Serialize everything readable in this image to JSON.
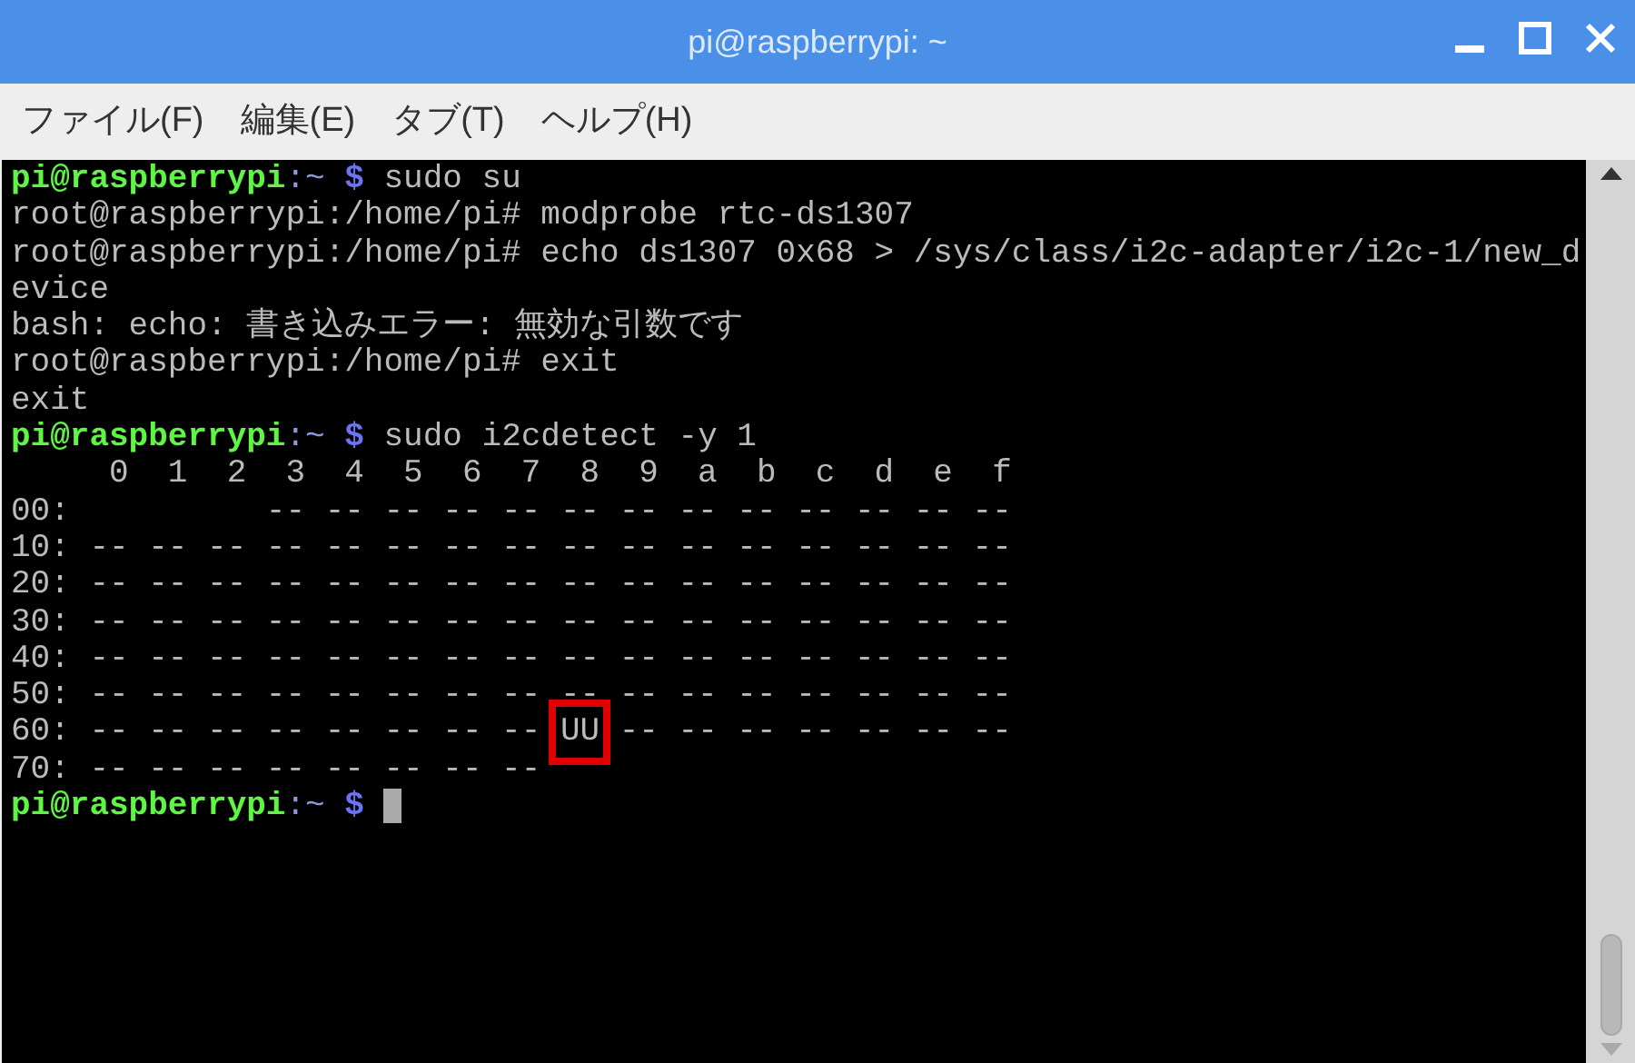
{
  "window": {
    "title": "pi@raspberrypi: ~"
  },
  "menu": [
    "ファイル(F)",
    "編集(E)",
    "タブ(T)",
    "ヘルプ(H)"
  ],
  "terminal": {
    "lines": [
      [
        {
          "kind": "user",
          "text": "pi@raspberrypi"
        },
        {
          "kind": "path",
          "text": ":~"
        },
        {
          "kind": "dollar",
          "text": " $"
        },
        {
          "kind": "text",
          "text": " sudo su"
        }
      ],
      [
        {
          "kind": "text",
          "text": "root@raspberrypi:/home/pi# modprobe rtc-ds1307"
        }
      ],
      [
        {
          "kind": "text",
          "text": "root@raspberrypi:/home/pi# echo ds1307 0x68 > /sys/class/i2c-adapter/i2c-1/new_d"
        }
      ],
      [
        {
          "kind": "text",
          "text": "evice"
        }
      ],
      [
        {
          "kind": "text",
          "text": "bash: echo: 書き込みエラー: 無効な引数です"
        }
      ],
      [
        {
          "kind": "text",
          "text": "root@raspberrypi:/home/pi# exit"
        }
      ],
      [
        {
          "kind": "text",
          "text": "exit"
        }
      ],
      [
        {
          "kind": "user",
          "text": "pi@raspberrypi"
        },
        {
          "kind": "path",
          "text": ":~"
        },
        {
          "kind": "dollar",
          "text": " $"
        },
        {
          "kind": "text",
          "text": " sudo i2cdetect -y 1"
        }
      ],
      [
        {
          "kind": "text",
          "text": "     0  1  2  3  4  5  6  7  8  9  a  b  c  d  e  f"
        }
      ],
      [
        {
          "kind": "text",
          "text": "00:          -- -- -- -- -- -- -- -- -- -- -- -- --"
        }
      ],
      [
        {
          "kind": "text",
          "text": "10: -- -- -- -- -- -- -- -- -- -- -- -- -- -- -- --"
        }
      ],
      [
        {
          "kind": "text",
          "text": "20: -- -- -- -- -- -- -- -- -- -- -- -- -- -- -- --"
        }
      ],
      [
        {
          "kind": "text",
          "text": "30: -- -- -- -- -- -- -- -- -- -- -- -- -- -- -- --"
        }
      ],
      [
        {
          "kind": "text",
          "text": "40: -- -- -- -- -- -- -- -- -- -- -- -- -- -- -- --"
        }
      ],
      [
        {
          "kind": "text",
          "text": "50: -- -- -- -- -- -- -- -- -- -- -- -- -- -- -- --"
        }
      ],
      [
        {
          "kind": "text",
          "text": "60: -- -- -- -- -- -- -- -- "
        },
        {
          "kind": "highlight",
          "text": "UU"
        },
        {
          "kind": "text",
          "text": " -- -- -- -- -- -- --"
        }
      ],
      [
        {
          "kind": "text",
          "text": "70: -- -- -- -- -- -- -- --"
        }
      ],
      [
        {
          "kind": "user",
          "text": "pi@raspberrypi"
        },
        {
          "kind": "path",
          "text": ":~"
        },
        {
          "kind": "dollar",
          "text": " $ "
        },
        {
          "kind": "cursor"
        }
      ]
    ]
  }
}
